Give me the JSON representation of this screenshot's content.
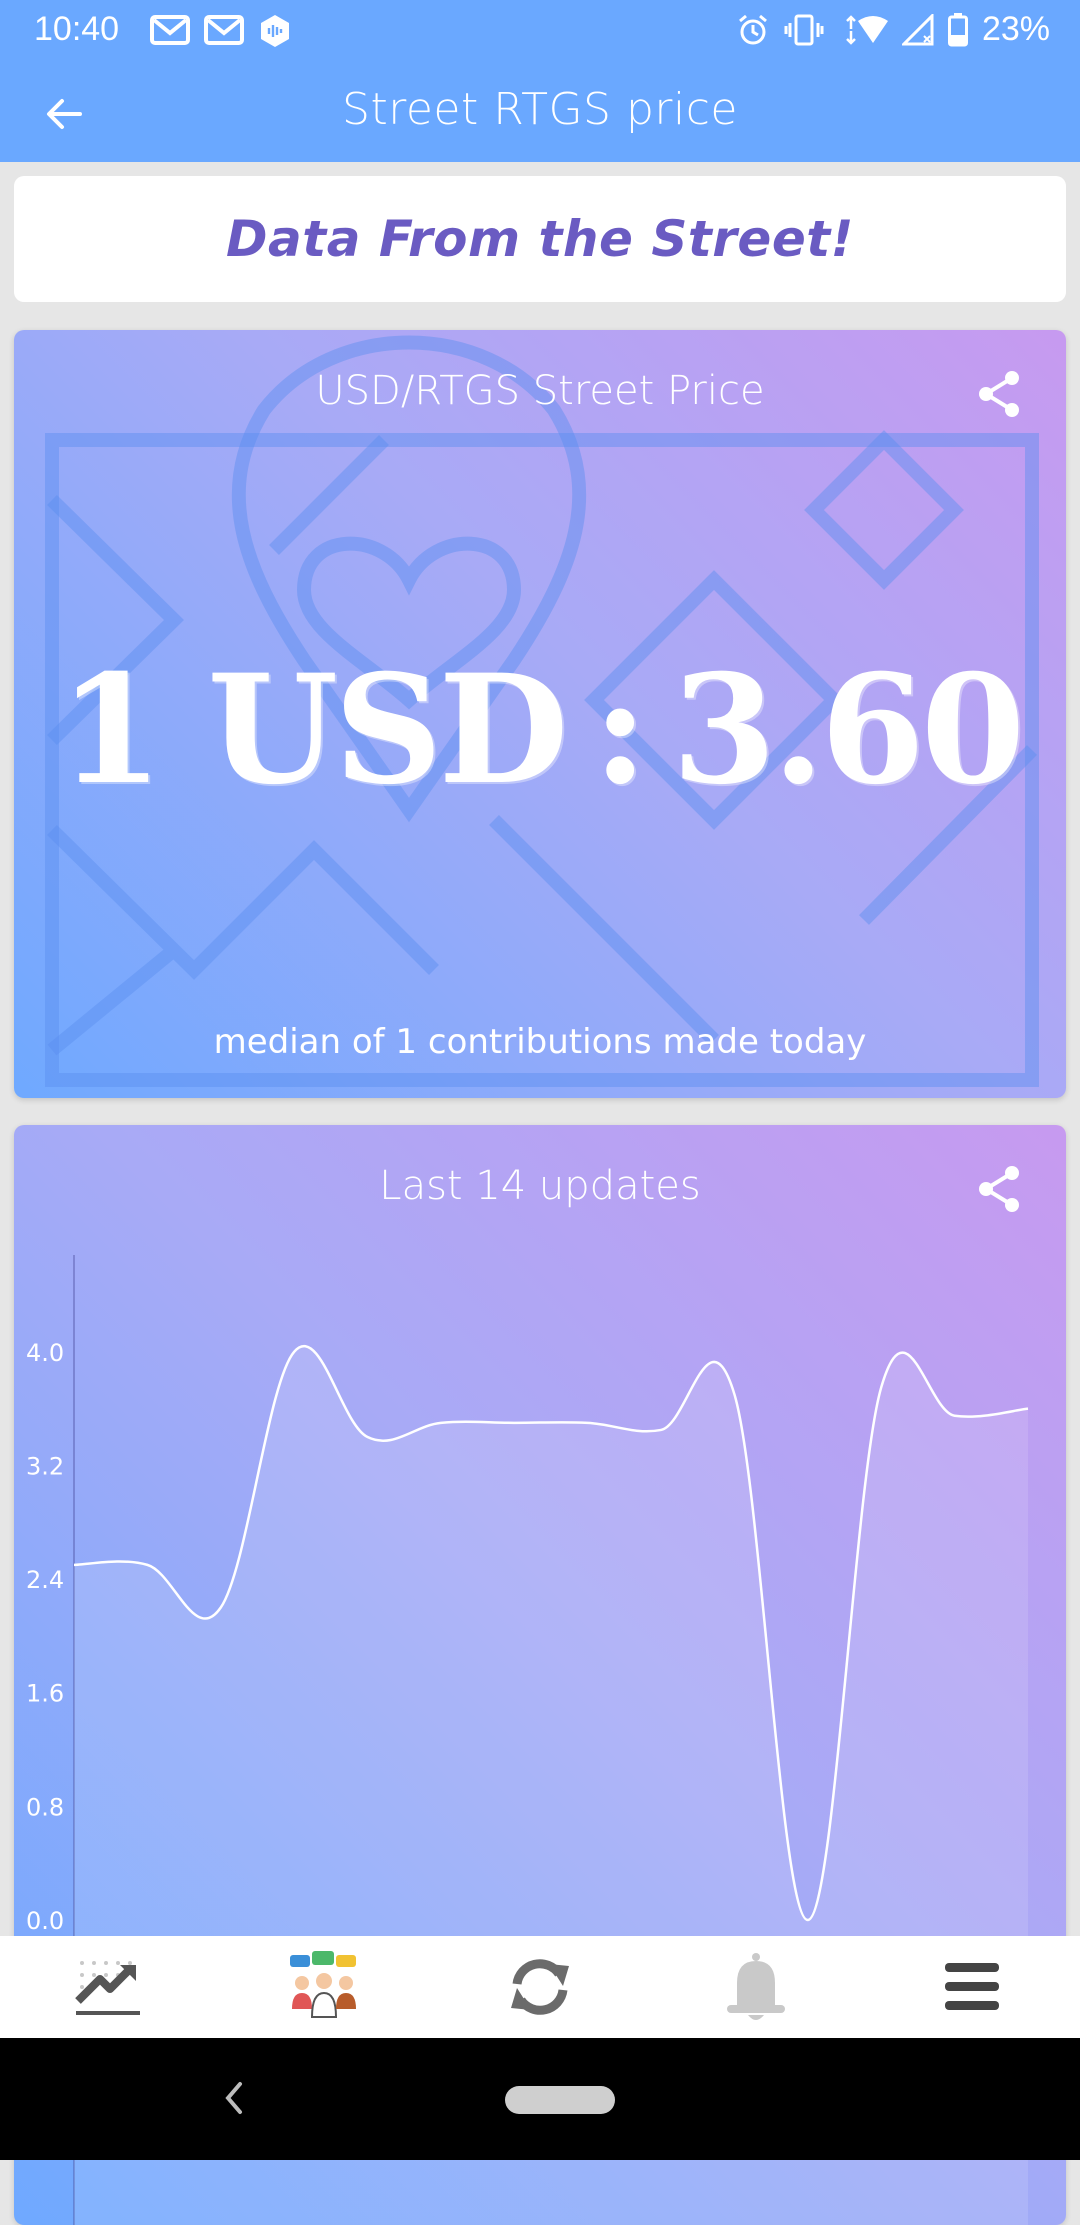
{
  "status_bar": {
    "time": "10:40",
    "battery": "23%",
    "left_icons": [
      "gmail-icon",
      "gmail-icon",
      "podcast-icon"
    ],
    "right_icons": [
      "alarm-icon",
      "vibrate-icon",
      "wifi-icon",
      "signal-icon",
      "battery-icon"
    ]
  },
  "app_bar": {
    "title": "Street RTGS price"
  },
  "banner": {
    "text": "Data From the Street!"
  },
  "price_card": {
    "title": "USD/RTGS Street Price",
    "base": "1 USD",
    "separator": ":",
    "rate": "3.60",
    "subtitle": "median of 1 contributions made today"
  },
  "chart_card": {
    "title": "Last 14 updates"
  },
  "chart_data": {
    "type": "line",
    "title": "Last 14 updates",
    "xlabel": "",
    "ylabel": "",
    "ylim": [
      0,
      4.4
    ],
    "yticks": [
      "4.0",
      "3.2",
      "2.4",
      "1.6",
      "0.8",
      "0.0"
    ],
    "grid": false,
    "x": [
      1,
      2,
      3,
      4,
      5,
      6,
      7,
      8,
      9,
      10,
      11,
      12,
      13,
      14
    ],
    "series": [
      {
        "values": [
          2.5,
          2.5,
          2.2,
          4.0,
          3.4,
          3.5,
          3.5,
          3.5,
          3.45,
          3.7,
          0.0,
          3.75,
          3.55,
          3.6
        ]
      }
    ],
    "line_color": "#ffffff"
  },
  "bottom_nav": {
    "items": [
      "trend-chart-icon",
      "community-chat-icon",
      "refresh-icon",
      "bell-icon",
      "menu-icon"
    ]
  },
  "colors": {
    "primary": "#6aa8ff",
    "banner_text": "#6a5bc2",
    "card_gradient_start": "#6fa9ff",
    "card_gradient_end": "#c79af0"
  }
}
